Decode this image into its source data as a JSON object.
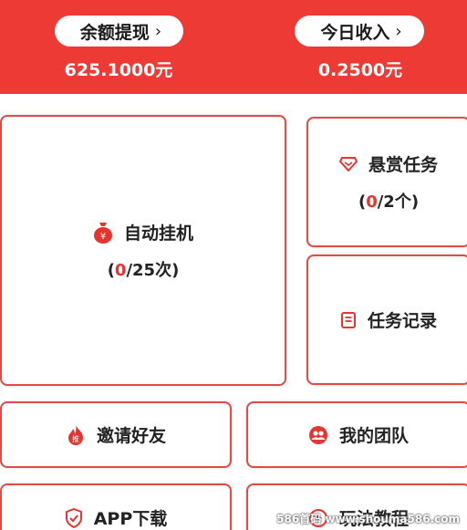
{
  "header": {
    "balance_label": "余额提现",
    "balance_value": "625.1000元",
    "income_label": "今日收入",
    "income_value": "0.2500元",
    "chevron": "›"
  },
  "cards": {
    "auto_hang": {
      "label": "自动挂机",
      "open": "(",
      "current": "0",
      "rest": "/25次)",
      "icon": "money-bag-icon"
    },
    "reward_task": {
      "label": "悬赏任务",
      "open": "(",
      "current": "0",
      "rest": "/2个)",
      "icon": "diamond-icon"
    },
    "task_record": {
      "label": "任务记录",
      "icon": "document-icon"
    },
    "invite": {
      "label": "邀请好友",
      "icon": "fire-icon"
    },
    "my_team": {
      "label": "我的团队",
      "icon": "team-icon"
    },
    "app_download": {
      "label": "APP下载",
      "icon": "shield-icon"
    },
    "tutorial": {
      "label": "玩法教程",
      "icon": "play-icon"
    }
  },
  "watermark": "586首码 www.shouma586.com",
  "colors": {
    "primary_red": "#ee3a35",
    "accent_red": "#e8332e",
    "card_border": "#e24b46"
  }
}
